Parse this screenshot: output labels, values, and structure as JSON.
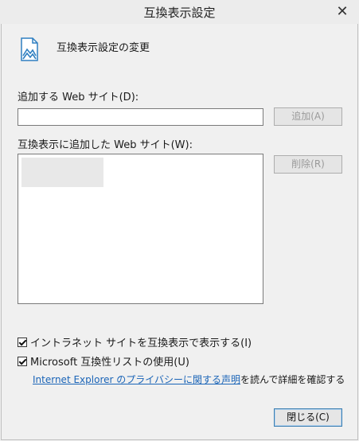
{
  "window": {
    "title": "互換表示設定",
    "close_glyph": "✕"
  },
  "header": {
    "title": "互換表示設定の変更",
    "icon": "compat-view-icon"
  },
  "add_site": {
    "label": "追加する Web サイト(D):",
    "value": "",
    "add_button": "追加(A)"
  },
  "site_list": {
    "label": "互換表示に追加した Web サイト(W):",
    "items": [
      ""
    ],
    "remove_button": "削除(R)"
  },
  "options": {
    "intranet": {
      "label": "イントラネット サイトを互換表示で表示する(I)",
      "checked": true
    },
    "ms_list": {
      "label": "Microsoft 互換性リストの使用(U)",
      "checked": true
    }
  },
  "privacy": {
    "link_text": "Internet Explorer のプライバシーに関する声明",
    "suffix": "を読んで詳細を確認する"
  },
  "footer": {
    "close_button": "閉じる(C)"
  }
}
